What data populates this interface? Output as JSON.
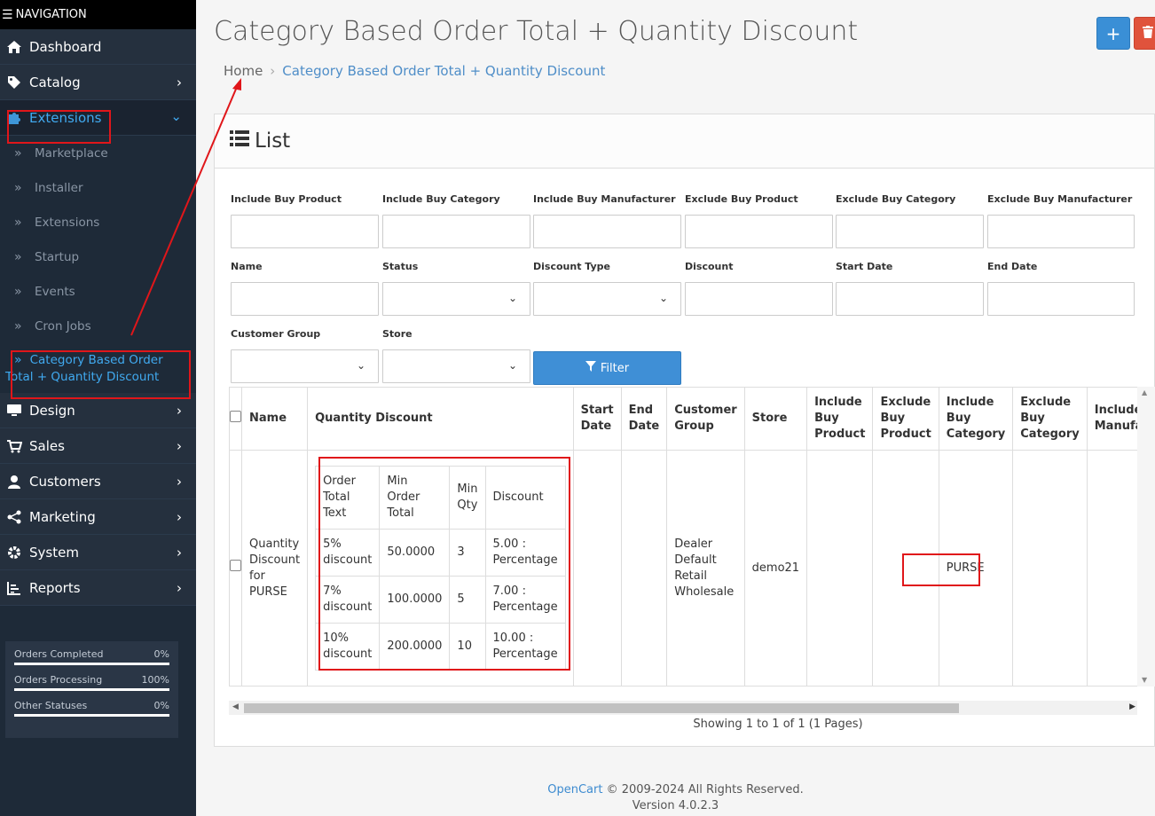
{
  "sidebar": {
    "header": "NAVIGATION",
    "items": [
      {
        "label": "Dashboard"
      },
      {
        "label": "Catalog"
      },
      {
        "label": "Extensions"
      },
      {
        "label": "Design"
      },
      {
        "label": "Sales"
      },
      {
        "label": "Customers"
      },
      {
        "label": "Marketing"
      },
      {
        "label": "System"
      },
      {
        "label": "Reports"
      }
    ],
    "sub_items": [
      {
        "label": "Marketplace"
      },
      {
        "label": "Installer"
      },
      {
        "label": "Extensions"
      },
      {
        "label": "Startup"
      },
      {
        "label": "Events"
      },
      {
        "label": "Cron Jobs"
      },
      {
        "label": "Category Based Order Total + Quantity Discount"
      }
    ],
    "stats": [
      {
        "label": "Orders Completed",
        "value": "0%",
        "progress": 0
      },
      {
        "label": "Orders Processing",
        "value": "100%",
        "progress": 100
      },
      {
        "label": "Other Statuses",
        "value": "0%",
        "progress": 0
      }
    ]
  },
  "page": {
    "title": "Category Based Order Total + Quantity Discount",
    "breadcrumb_home": "Home",
    "breadcrumb_current": "Category Based Order Total + Quantity Discount",
    "add_icon": "plus-icon",
    "delete_icon": "trash-icon"
  },
  "panel": {
    "title": "List",
    "filters": {
      "include_buy_product": "Include Buy Product",
      "include_buy_category": "Include Buy Category",
      "include_buy_manufacturer": "Include Buy Manufacturer",
      "exclude_buy_product": "Exclude Buy Product",
      "exclude_buy_category": "Exclude Buy Category",
      "exclude_buy_manufacturer": "Exclude Buy Manufacturer",
      "name": "Name",
      "status": "Status",
      "discount_type": "Discount Type",
      "discount": "Discount",
      "start_date": "Start Date",
      "end_date": "End Date",
      "customer_group": "Customer Group",
      "store": "Store",
      "filter_button": "Filter"
    },
    "table": {
      "headers": {
        "name": "Name",
        "quantity_discount": "Quantity Discount",
        "start_date": "Start Date",
        "end_date": "End Date",
        "customer_group": "Customer Group",
        "store": "Store",
        "include_buy_product": "Include Buy Product",
        "exclude_buy_product": "Exclude Buy Product",
        "include_buy_category": "Include Buy Category",
        "exclude_buy_category": "Exclude Buy Category",
        "include_buy_manufacturer": "Include Buy Manufacturer"
      },
      "row": {
        "name": "Quantity Discount for PURSE",
        "start_date": "",
        "end_date": "",
        "customer_group": "Dealer Default Retail Wholesale",
        "store": "demo21",
        "include_buy_product": "",
        "exclude_buy_product": "",
        "include_buy_category": "PURSE",
        "exclude_buy_category": "",
        "include_buy_manufacturer": ""
      },
      "inner_headers": {
        "text": "Order Total Text",
        "min_total": "Min Order Total",
        "min_qty": "Min Qty",
        "discount": "Discount"
      },
      "inner_rows": [
        {
          "text": "5% discount",
          "min_total": "50.0000",
          "min_qty": "3",
          "discount": "5.00 : Percentage"
        },
        {
          "text": "7% discount",
          "min_total": "100.0000",
          "min_qty": "5",
          "discount": "7.00 : Percentage"
        },
        {
          "text": "10% discount",
          "min_total": "200.0000",
          "min_qty": "10",
          "discount": "10.00 : Percentage"
        }
      ]
    },
    "showing": "Showing 1 to 1 of 1 (1 Pages)"
  },
  "footer": {
    "brand": "OpenCart",
    "copyright": " © 2009-2024 All Rights Reserved.",
    "version": "Version 4.0.2.3"
  },
  "colors": {
    "sidebar_bg": "#1e2a38",
    "accent": "#3a8fd6",
    "danger": "#e0533c",
    "annotation": "#e0161a"
  }
}
